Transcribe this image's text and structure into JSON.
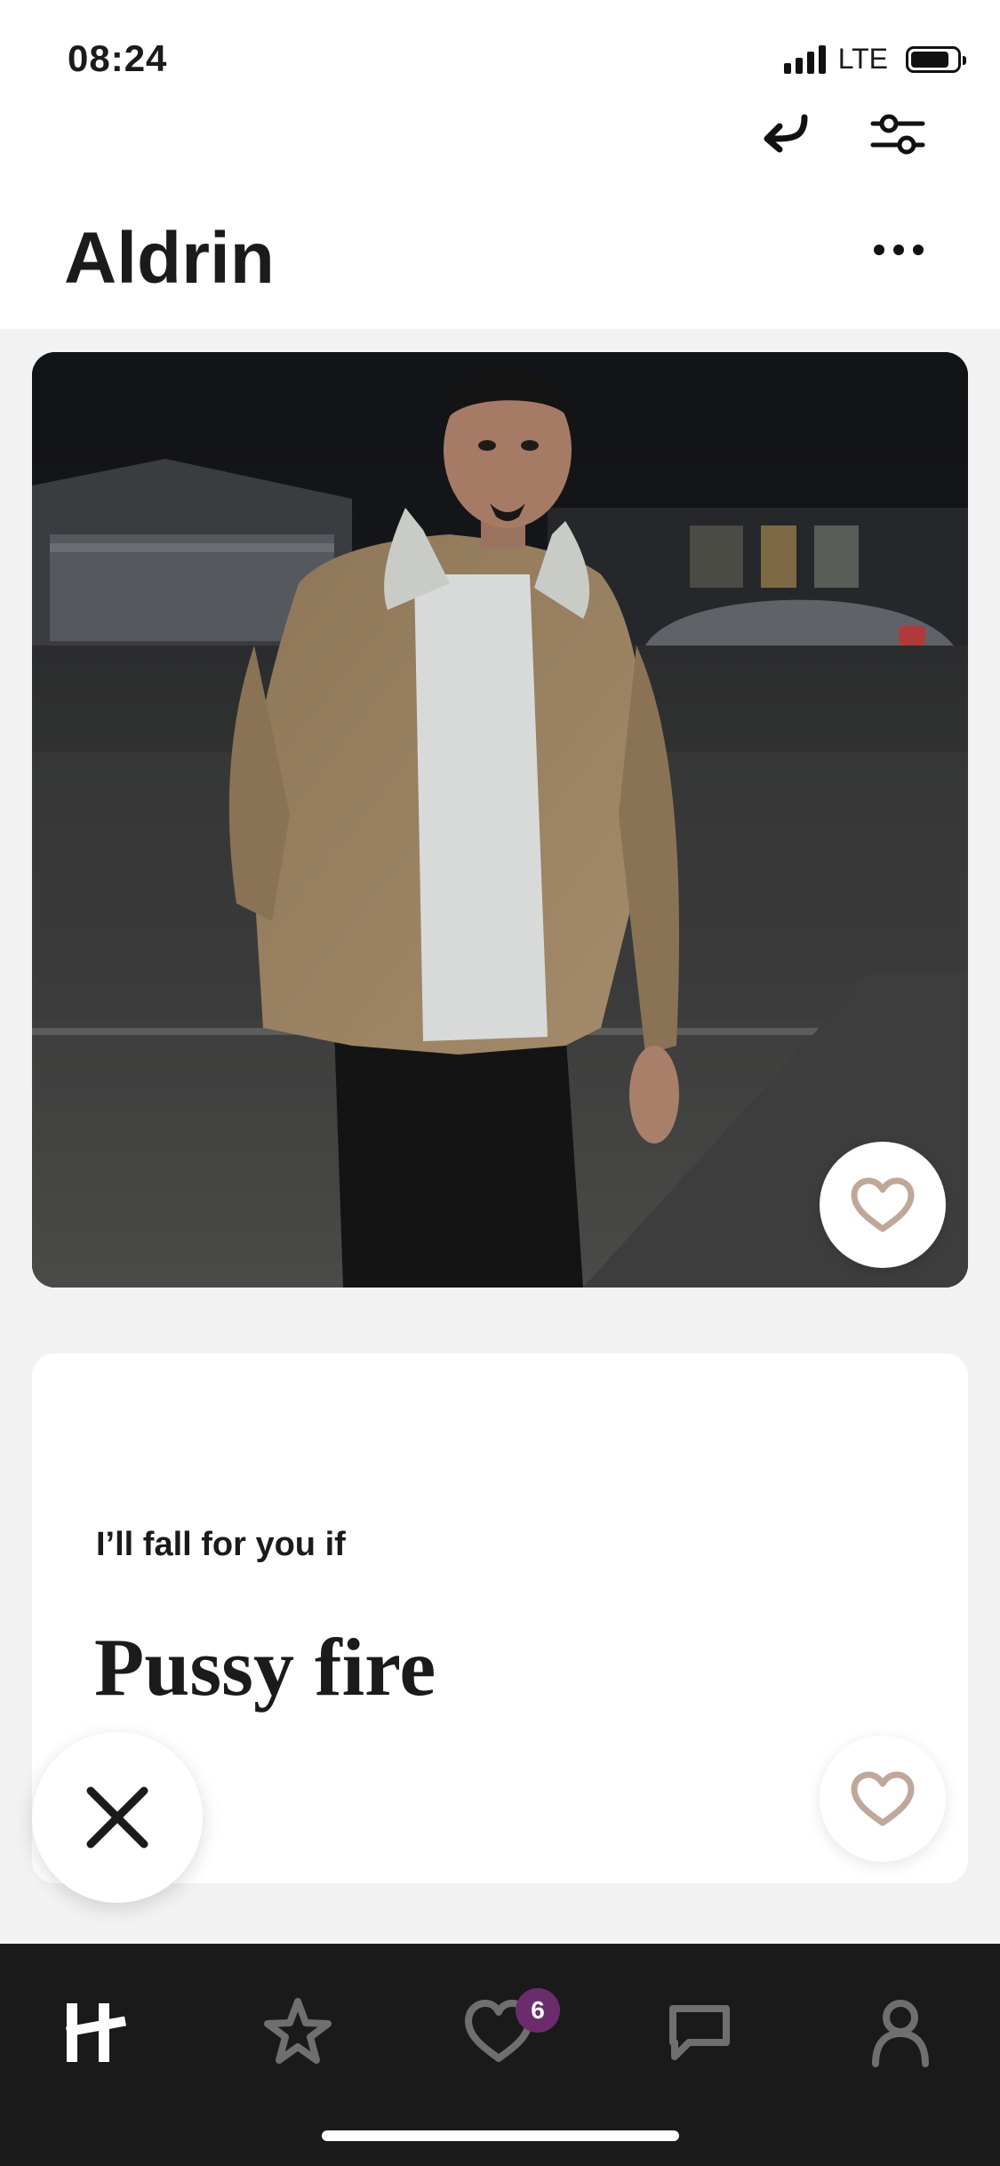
{
  "status_bar": {
    "time": "08:24",
    "network": "LTE"
  },
  "header": {
    "name": "Aldrin"
  },
  "prompt": {
    "question": "I’ll fall for you if",
    "answer": "Pussy fire"
  },
  "tabs": {
    "likes_badge": "6"
  },
  "colors": {
    "accent_heart": "#BFA79A",
    "badge": "#6B2C6B",
    "tabbar_bg": "#1A1A1A",
    "tab_icon_inactive": "#6F6F6F"
  },
  "icons": {
    "undo": "undo-arrow-icon",
    "filter": "sliders-icon",
    "more": "ellipsis-icon",
    "like": "heart-icon",
    "skip": "x-icon",
    "home": "hinge-logo-icon",
    "standouts": "star-icon",
    "likes": "heart-tab-icon",
    "messages": "chat-icon",
    "profile": "person-icon"
  }
}
